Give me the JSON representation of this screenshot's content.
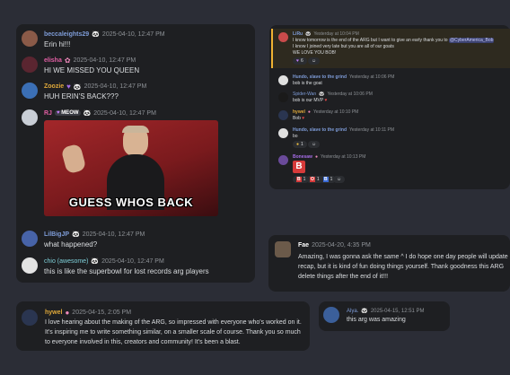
{
  "left_card": {
    "messages": [
      {
        "user": "beccaleights29",
        "time": "2025-04-10, 12:47 PM",
        "text": "Erin hi!!!",
        "color": "#7e9cd8"
      },
      {
        "user": "elisha",
        "time": "2025-04-10, 12:47 PM",
        "text": "HI WE MISSED YOU QUEEN",
        "color": "#e35fa5"
      },
      {
        "user": "Zoozie",
        "time": "2025-04-10, 12:47 PM",
        "text": "HUH ERIN'S BACK???",
        "color": "#a66de9"
      },
      {
        "user": "RJ",
        "tag": "MEOW",
        "time": "2025-04-10, 12:47 PM",
        "color": "#e35fa5"
      },
      {
        "user": "LilBigJP",
        "time": "2025-04-10, 12:47 PM",
        "text": "what happened?",
        "color": "#7e9cd8"
      },
      {
        "user": "chio (awesome)",
        "time": "2025-04-10, 12:47 PM",
        "text": "this is like the superbowl for lost records arg players",
        "color": "#7ecfd8"
      }
    ],
    "gif_caption": "GUESS WHOS BACK"
  },
  "right_top": {
    "msg1": {
      "user": "LiRu",
      "time": "Yesterday at 10:04 PM",
      "line1": "I know tomorrow is the end of the ARG but I want to give an early thank you to",
      "mention": "@CyberAmerica_Bob",
      "line2": "I know I joined very late but you are all of our goats",
      "line3": "WE LOVE YOU BOB!",
      "reaction_count": "6"
    },
    "msg2": {
      "user": "Hundo, slave to the grind",
      "time": "Yesterday at 10:06 PM",
      "text": "bob is the goat"
    },
    "msg3": {
      "user": "Spider-Wan",
      "time": "Yesterday at 10:06 PM",
      "text": "bob is our MVP"
    },
    "msg4": {
      "user": "hywel",
      "time": "Yesterday at 10:10 PM",
      "text": "Bob"
    },
    "msg5": {
      "user": "Hundo, slave to the grind",
      "time": "Yesterday at 10:11 PM",
      "text": "bo",
      "reaction_count": "1"
    },
    "msg6": {
      "user": "Bonesaw",
      "time": "Yesterday at 10:13 PM",
      "big_letter": "B",
      "reactions": [
        "1",
        "1",
        "1"
      ],
      "reaction_letters": [
        "B",
        "O",
        "B"
      ]
    }
  },
  "fae": {
    "user": "Fae",
    "time": "2025-04-20, 4:35 PM",
    "text": "Amazing, I was gonna ask the same ^ I do hope one day people will update recap, but it is kind of fun doing things yourself. Thank goodness this ARG delete things after the end of it!!!"
  },
  "hywel_card": {
    "user": "hywel",
    "time": "2025-04-15, 2:05 PM",
    "text": "I love hearing about the making of the ARG, so impressed with everyone who's worked on it. It's inspiring me to write something similar, on a smaller scale of course. Thank you so much to everyone involved in this, creators and community! It's been a blast."
  },
  "alya_card": {
    "user": "Alya.",
    "time": "2025-04-15, 12:51 PM",
    "text": "this arg was amazing"
  }
}
